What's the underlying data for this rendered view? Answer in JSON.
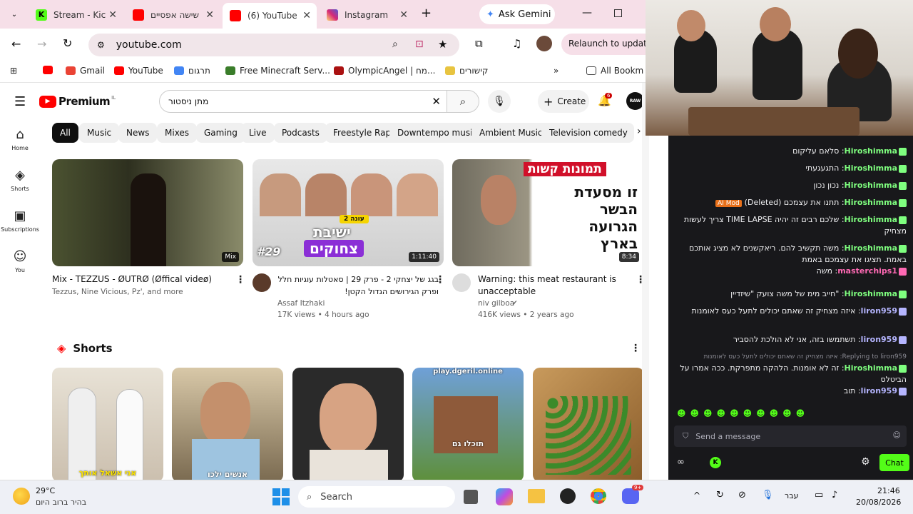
{
  "tabs": [
    {
      "title": "Stream - Kic",
      "color": "#53fc18"
    },
    {
      "title": "שישה אפסיים",
      "color": "#ff0000"
    },
    {
      "title": "(6) YouTube",
      "color": "#ff0000",
      "active": true
    },
    {
      "title": "Instagram",
      "color": "#d62976"
    }
  ],
  "gemini": "Ask Gemini",
  "url": "youtube.com",
  "relaunch": "Relaunch to update",
  "bookmarks": [
    "Gmail",
    "YouTube",
    "תרגום",
    "Free Minecraft Serv...",
    "OlympicAngel | מח...",
    "קישורים"
  ],
  "all_bookmarks": "All Bookmarks",
  "yt": {
    "logo": "Premium",
    "logo_sup": "IL",
    "search_value": "מתן ניסטור",
    "create": "Create",
    "notif_count": "6",
    "avatar": "RAW",
    "chips": [
      "All",
      "Music",
      "News",
      "Mixes",
      "Gaming",
      "Live",
      "Podcasts",
      "Freestyle Rap",
      "Downtempo music",
      "Ambient Music",
      "Television comedy"
    ],
    "sidebar": [
      "Home",
      "Shorts",
      "Subscriptions",
      "You"
    ],
    "videos": [
      {
        "title": "Mix - TEZZUS - ØUTRØ (Øffical videø)",
        "channel": "Tezzus, Nine Vicious, Pz', and more",
        "meta": "",
        "badge": "Mix"
      },
      {
        "title": "בגג של יצחקי 2 - פרק 29 | סאטלות עוגיות חלל ופרק הגירושים הגדול הקטן!",
        "channel": "Assaf Itzhaki",
        "meta": "17K views • 4 hours ago",
        "duration": "1:11:40"
      },
      {
        "title": "Warning: this meat restaurant is unacceptable",
        "channel": "niv gilboa",
        "meta": "416K views • 2 years ago",
        "duration": "8:34"
      }
    ],
    "thumb2_text": [
      "עונה 2",
      "ישיבת",
      "צחוקים",
      "#29"
    ],
    "thumb3_text": [
      "תמונות קשות",
      "זו מסעדת",
      "הבשר",
      "הגרועה",
      "בארץ"
    ],
    "shorts_title": "Shorts",
    "shorts_text": [
      "אני אשאל אותך",
      "אנשים ילכו",
      "play.dgeril.online",
      "תוכלו גם"
    ]
  },
  "chat": {
    "messages": [
      {
        "user": "Hiroshimma",
        "text": "סלאם עליקום",
        "color": "#7fff7f"
      },
      {
        "user": "Hiroshimma",
        "text": "התגעגעתי",
        "color": "#7fff7f"
      },
      {
        "user": "Hiroshimma",
        "text": "נכון נכון",
        "color": "#7fff7f"
      },
      {
        "user": "Hiroshimma",
        "text": "תתנו את עצמכם (Deleted)",
        "color": "#7fff7f",
        "tag": "AI Mod"
      },
      {
        "user": "Hiroshimma",
        "text": "שלכם רבים זה יהיה TIME LAPSE צריך לעשות מצחיק",
        "color": "#7fff7f"
      },
      {
        "user": "Hiroshimma",
        "text": "משה תקשיב להם. ריאקשנים לא מציג אותכם באמת. תציגו את עצמכם באמת",
        "color": "#7fff7f"
      },
      {
        "user": "masterchips1",
        "text": "משה",
        "color": "#ff69b4"
      },
      {
        "user": "Hiroshimma",
        "text": "\"חייב מימ של משה צועק \"שיזדיין",
        "color": "#7fff7f"
      },
      {
        "user": "liron959",
        "text": "איזה מצחיק זה שאתם יכולים לתעל כעס לאומנות",
        "color": "#b5b5ff"
      },
      {
        "user": "liron959",
        "text": "תשתמשו בזה, אני לא הולכת להסביר",
        "color": "#b5b5ff"
      },
      {
        "user": "Hiroshimma",
        "text": "זה לא אומנות. הלהקה מתפרקת. ככה אמרו על הביטלס",
        "color": "#7fff7f",
        "reply": "Replying to liron959: איזה מצחיק זה שאתם יכולים לתעל כעס לאומנות"
      },
      {
        "user": "liron959",
        "text": "תוב",
        "color": "#b5b5ff"
      }
    ],
    "placeholder": "Send a message",
    "chat_button": "Chat"
  },
  "taskbar": {
    "weather_temp": "29°C",
    "weather_desc": "בהיר ברוב היום",
    "search": "Search",
    "lang": "עבר",
    "time": "21:46",
    "date": "20/08/2026",
    "discord_badge": "9+"
  }
}
